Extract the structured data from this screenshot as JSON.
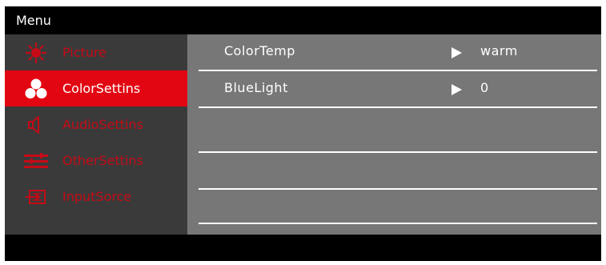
{
  "header": {
    "title": "Menu"
  },
  "sidebar": {
    "items": [
      {
        "label": "Picture",
        "icon": "brightness-icon",
        "active": false
      },
      {
        "label": "ColorSettins",
        "icon": "color-icon",
        "active": true
      },
      {
        "label": "AudioSettins",
        "icon": "speaker-icon",
        "active": false
      },
      {
        "label": "OtherSettins",
        "icon": "sliders-icon",
        "active": false
      },
      {
        "label": "InputSorce",
        "icon": "input-icon",
        "active": false
      }
    ]
  },
  "content": {
    "rows": [
      {
        "label": "ColorTemp",
        "value": "warm"
      },
      {
        "label": "BlueLight",
        "value": "0"
      },
      {
        "label": "",
        "value": ""
      },
      {
        "label": "",
        "value": ""
      },
      {
        "label": "",
        "value": ""
      }
    ]
  },
  "colors": {
    "accent": "#e20612",
    "inactive_text": "#c50b17",
    "sidebar_bg": "#3a3a3a",
    "content_bg": "#777777"
  }
}
